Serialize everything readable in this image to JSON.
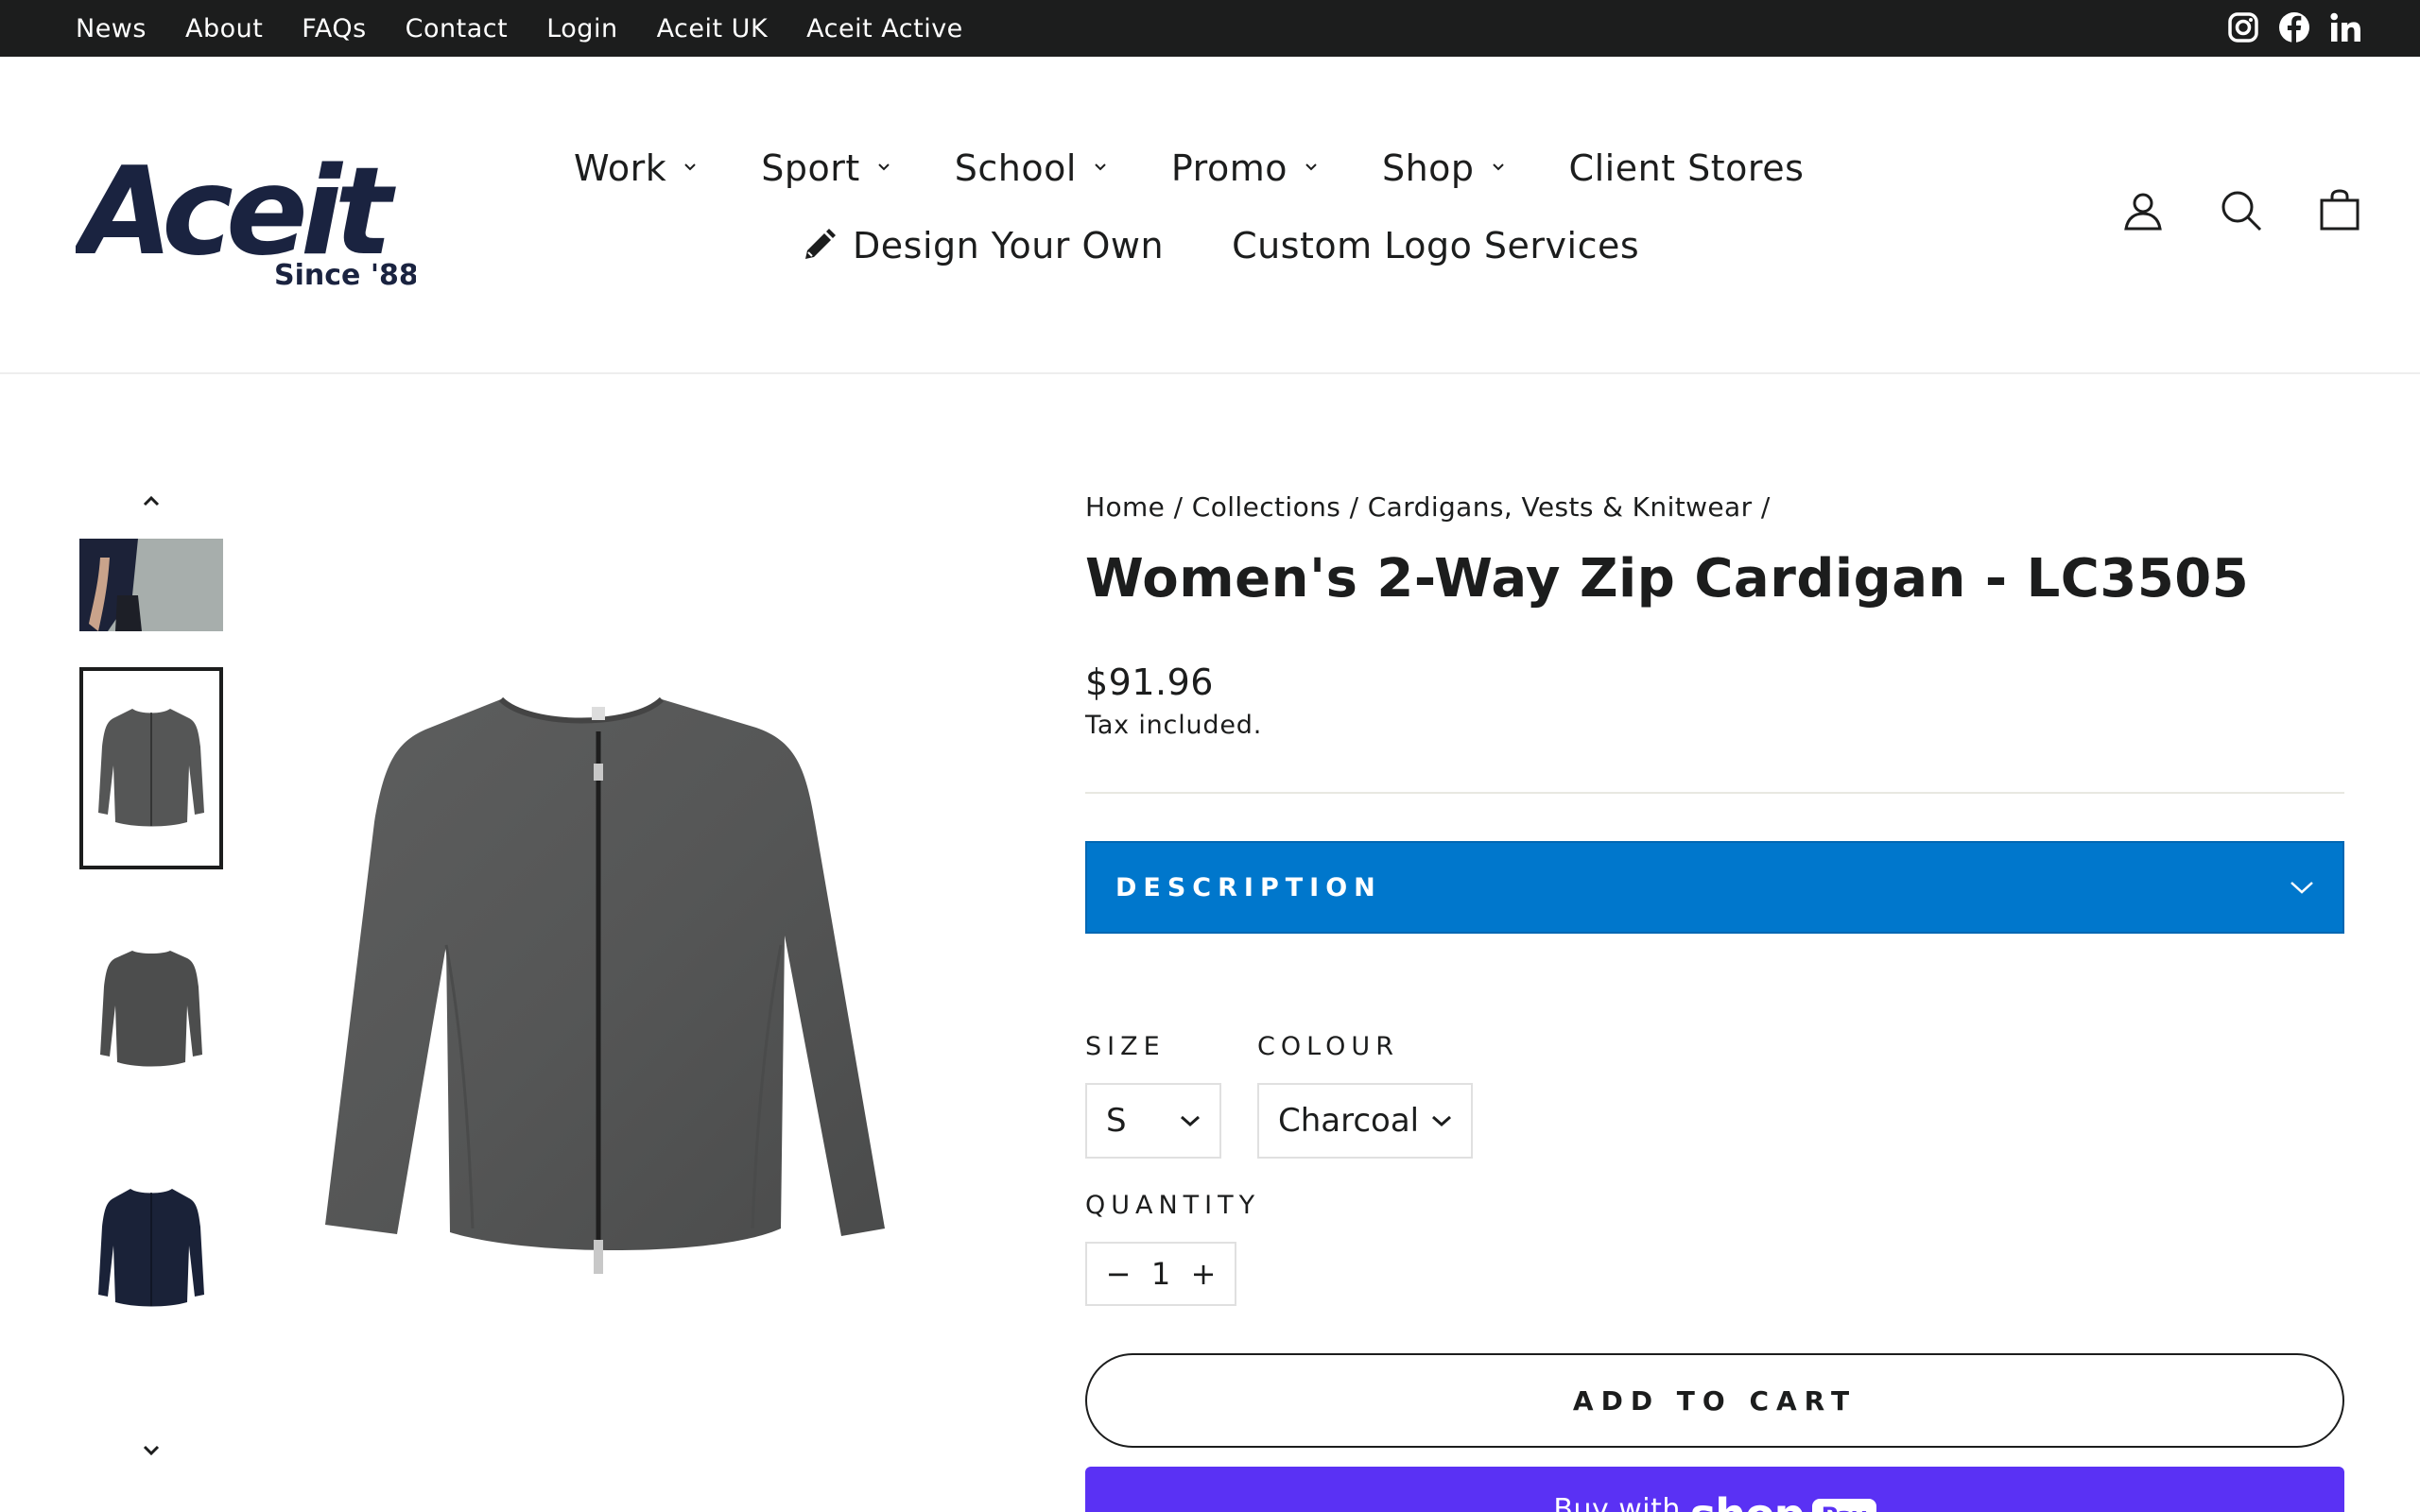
{
  "topbar": {
    "links": [
      "News",
      "About",
      "FAQs",
      "Contact",
      "Login",
      "Aceit UK",
      "Aceit Active"
    ],
    "social_icons": [
      "instagram-icon",
      "facebook-icon",
      "linkedin-icon"
    ]
  },
  "logo": {
    "brand": "Aceit",
    "tagline": "Since '88",
    "color": "#1a2340"
  },
  "nav": {
    "row1": [
      {
        "label": "Work",
        "dropdown": true
      },
      {
        "label": "Sport",
        "dropdown": true
      },
      {
        "label": "School",
        "dropdown": true
      },
      {
        "label": "Promo",
        "dropdown": true
      },
      {
        "label": "Shop",
        "dropdown": true
      },
      {
        "label": "Client Stores",
        "dropdown": false
      }
    ],
    "row2": [
      {
        "label": "Design Your Own",
        "icon": "pencil-icon"
      },
      {
        "label": "Custom Logo Services"
      }
    ],
    "header_icons": [
      "account-icon",
      "search-icon",
      "cart-icon"
    ]
  },
  "breadcrumb": {
    "items": [
      "Home",
      "Collections",
      "Cardigans, Vests & Knitwear"
    ],
    "separator": "/"
  },
  "product": {
    "title": "Women's 2-Way Zip Cardigan - LC3505",
    "price": "$91.96",
    "tax_note": "Tax included.",
    "description_label": "DESCRIPTION",
    "size_label": "SIZE",
    "size_value": "S",
    "colour_label": "COLOUR",
    "colour_value": "Charcoal",
    "quantity_label": "QUANTITY",
    "quantity_value": "1",
    "qty_minus": "−",
    "qty_plus": "+",
    "add_to_cart": "ADD TO CART",
    "shop_pay_prefix": "Buy with",
    "shop_pay_brand": "shop",
    "shop_pay_badge": "Pay"
  },
  "colors": {
    "topbar_bg": "#1c1d1d",
    "description_bar": "#0077cc",
    "shop_pay": "#5a31f4",
    "text": "#1c1d1d"
  }
}
